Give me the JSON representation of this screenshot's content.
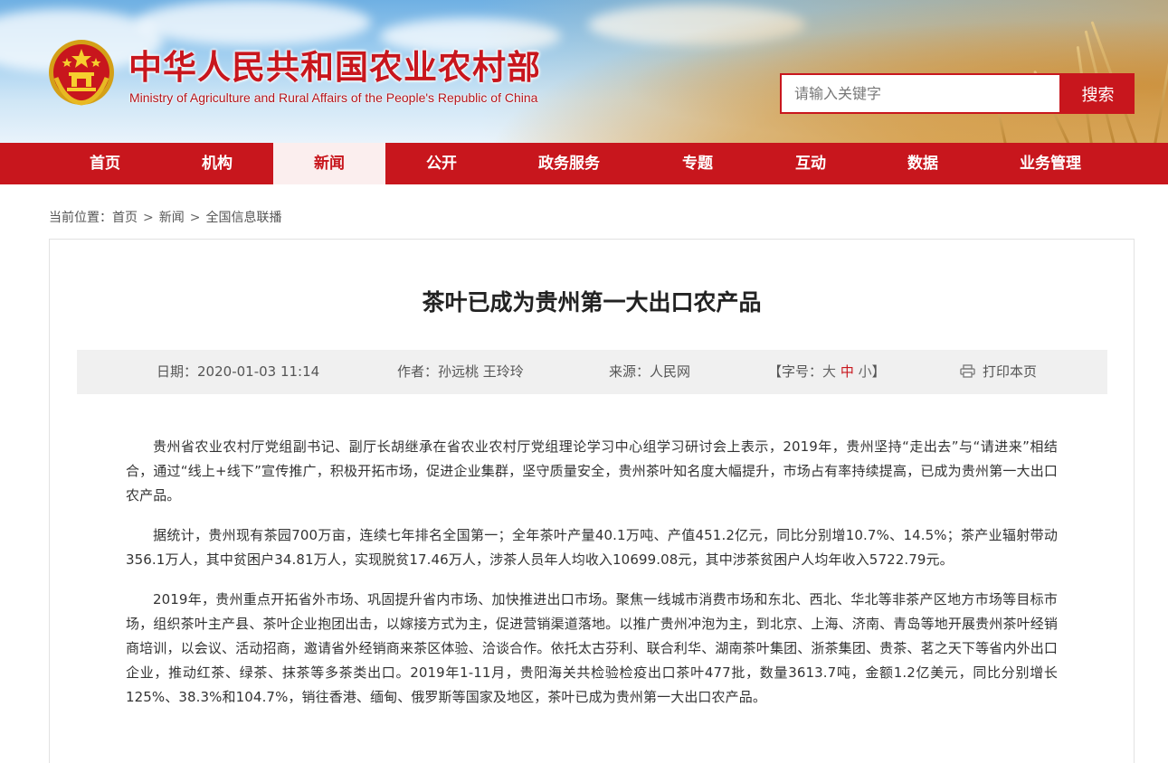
{
  "header": {
    "title_cn": "中华人民共和国农业农村部",
    "title_en": "Ministry of Agriculture and Rural Affairs of the People's Republic of China",
    "emblem_icon": "national-emblem-icon"
  },
  "search": {
    "placeholder": "请输入关键字",
    "button_label": "搜索"
  },
  "nav": {
    "items": [
      {
        "label": "首页"
      },
      {
        "label": "机构"
      },
      {
        "label": "新闻"
      },
      {
        "label": "公开"
      },
      {
        "label": "政务服务"
      },
      {
        "label": "专题"
      },
      {
        "label": "互动"
      },
      {
        "label": "数据"
      },
      {
        "label": "业务管理"
      }
    ],
    "active": "新闻"
  },
  "breadcrumb": {
    "prefix": "当前位置：",
    "items": [
      "首页",
      "新闻",
      "全国信息联播"
    ],
    "separator": ">"
  },
  "article": {
    "title": "茶叶已成为贵州第一大出口农产品",
    "meta": {
      "date_label": "日期：",
      "date": "2020-01-03 11:14",
      "author_label": "作者：",
      "author": "孙远桃 王玲玲",
      "source_label": "来源：",
      "source": "人民网",
      "font_size_open": "【字号：",
      "font_size_close": "】",
      "font_sizes": [
        "大",
        "中",
        "小"
      ],
      "font_size_active": "中",
      "print_label": "打印本页",
      "print_icon": "printer-icon"
    },
    "paragraphs": [
      "贵州省农业农村厅党组副书记、副厅长胡继承在省农业农村厅党组理论学习中心组学习研讨会上表示，2019年，贵州坚持“走出去”与“请进来”相结合，通过“线上+线下”宣传推广，积极开拓市场，促进企业集群，坚守质量安全，贵州茶叶知名度大幅提升，市场占有率持续提高，已成为贵州第一大出口农产品。",
      "据统计，贵州现有茶园700万亩，连续七年排名全国第一；全年茶叶产量40.1万吨、产值451.2亿元，同比分别增10.7%、14.5%；茶产业辐射带动356.1万人，其中贫困户34.81万人，实现脱贫17.46万人，涉茶人员年人均收入10699.08元，其中涉茶贫困户人均年收入5722.79元。",
      "2019年，贵州重点开拓省外市场、巩固提升省内市场、加快推进出口市场。聚焦一线城市消费市场和东北、西北、华北等非茶产区地方市场等目标市场，组织茶叶主产县、茶叶企业抱团出击，以嫁接方式为主，促进营销渠道落地。以推广贵州冲泡为主，到北京、上海、济南、青岛等地开展贵州茶叶经销商培训，以会议、活动招商，邀请省外经销商来茶区体验、洽谈合作。依托太古芬利、联合利华、湖南茶叶集团、浙茶集团、贵茶、茗之天下等省内外出口企业，推动红茶、绿茶、抹茶等多茶类出口。2019年1-11月，贵阳海关共检验检疫出口茶叶477批，数量3613.7吨，金额1.2亿美元，同比分别增长125%、38.3%和104.7%，销往香港、缅甸、俄罗斯等国家及地区，茶叶已成为贵州第一大出口农产品。"
    ]
  },
  "colors": {
    "brand_red": "#c8161d",
    "nav_active_bg": "#fbeeee",
    "meta_bg": "#f0f0f0"
  }
}
